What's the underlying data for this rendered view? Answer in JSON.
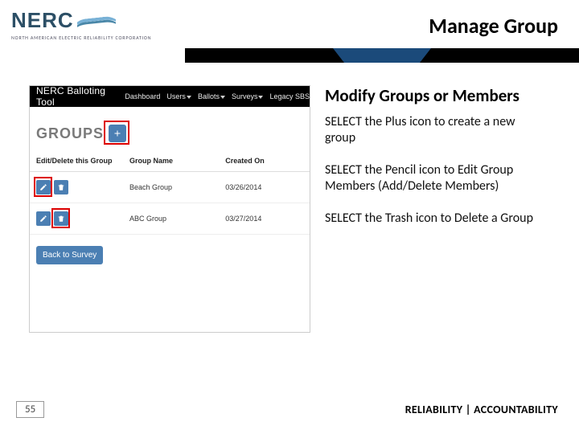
{
  "logo": {
    "main": "NERC",
    "sub": "NORTH AMERICAN ELECTRIC RELIABILITY CORPORATION"
  },
  "page_title": "Manage Group",
  "app": {
    "brand": "NERC Balloting Tool",
    "nav": {
      "dashboard": "Dashboard",
      "users": "Users",
      "ballots": "Ballots",
      "surveys": "Surveys",
      "legacy": "Legacy SBS"
    },
    "groups_label": "GROUPS",
    "table": {
      "headers": {
        "edit": "Edit/Delete this Group",
        "name": "Group Name",
        "created": "Created On"
      },
      "rows": [
        {
          "name": "Beach Group",
          "created": "03/26/2014"
        },
        {
          "name": "ABC Group",
          "created": "03/27/2014"
        }
      ]
    },
    "back_label": "Back to Survey"
  },
  "section_title": "Modify Groups or Members",
  "instructions": {
    "plus": "SELECT the Plus icon to create a new group",
    "pencil": "SELECT the Pencil icon to Edit Group Members (Add/Delete Members)",
    "trash": "SELECT the Trash icon to Delete a Group"
  },
  "footer": {
    "page": "55",
    "tagline": "RELIABILITY | ACCOUNTABILITY"
  }
}
